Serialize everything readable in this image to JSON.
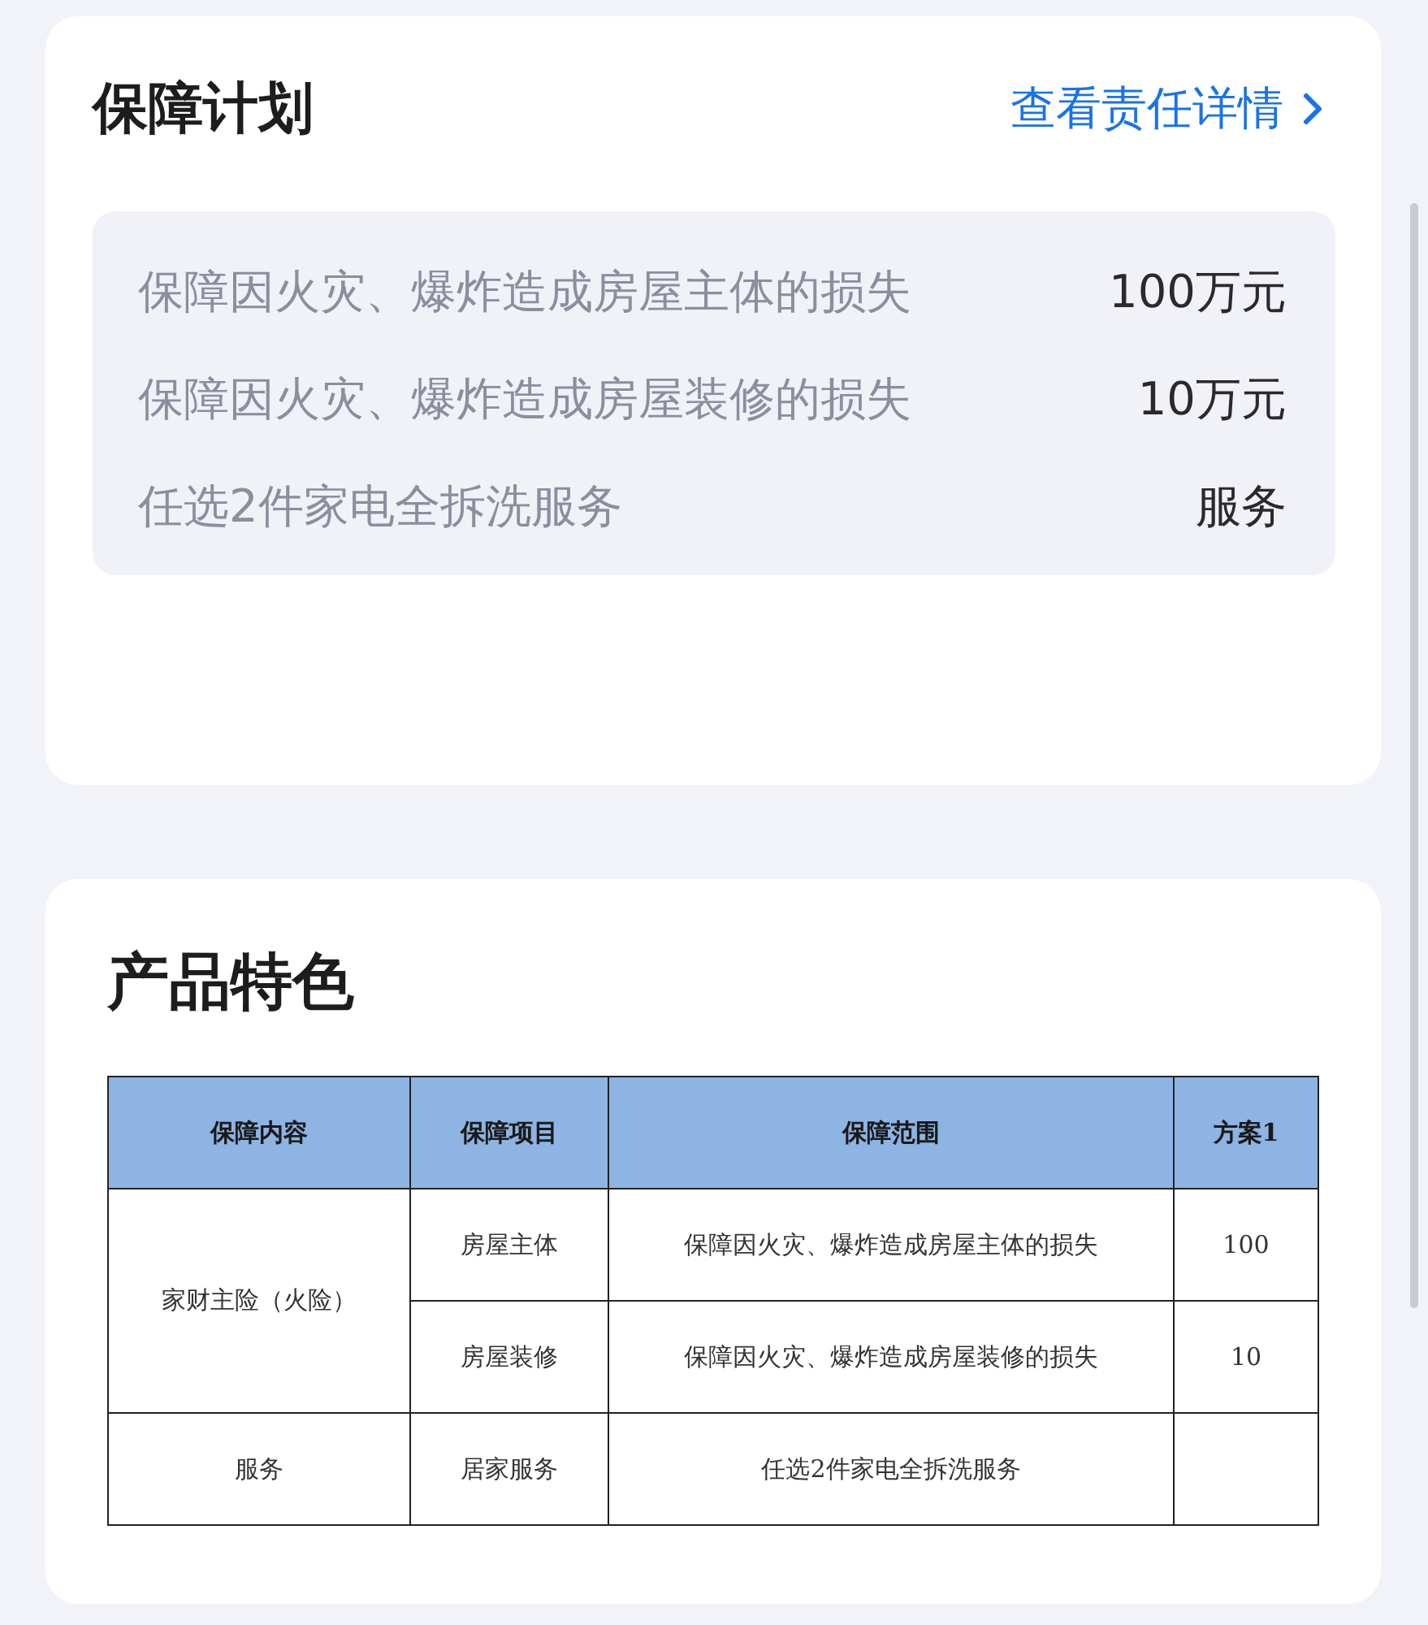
{
  "plan_card": {
    "title": "保障计划",
    "details_link": "查看责任详情",
    "coverages": [
      {
        "label": "保障因火灾、爆炸造成房屋主体的损失",
        "value": "100万元"
      },
      {
        "label": "保障因火灾、爆炸造成房屋装修的损失",
        "value": "10万元"
      },
      {
        "label": "任选2件家电全拆洗服务",
        "value": "服务"
      }
    ]
  },
  "features_card": {
    "title": "产品特色",
    "table": {
      "columns": [
        "保障内容",
        "保障项目",
        "保障范围",
        "方案1"
      ],
      "groups": [
        {
          "category": "家财主险（火险）",
          "rows": [
            {
              "item": "房屋主体",
              "scope": "保障因火灾、爆炸造成房屋主体的损失",
              "plan": "100"
            },
            {
              "item": "房屋装修",
              "scope": "保障因火灾、爆炸造成房屋装修的损失",
              "plan": "10"
            }
          ]
        },
        {
          "category": "服务",
          "rows": [
            {
              "item": "居家服务",
              "scope": "任选2件家电全拆洗服务"
            }
          ]
        }
      ]
    }
  }
}
